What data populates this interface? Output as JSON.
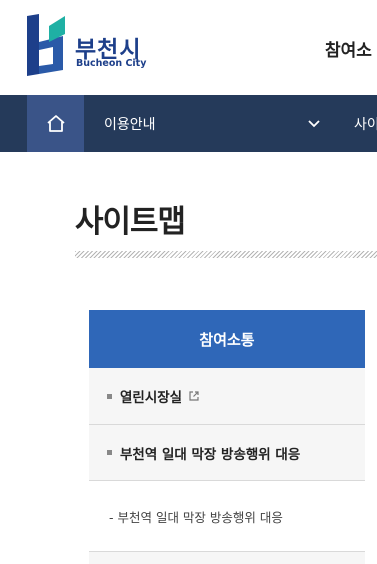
{
  "header": {
    "logo_ko": "부천시",
    "logo_en": "Bucheon City",
    "top_menu": "참여소"
  },
  "nav": {
    "home_icon": "home-icon",
    "item1": "이용안내",
    "item2": "사이"
  },
  "page": {
    "title": "사이트맵"
  },
  "sitemap": {
    "section_title": "참여소통",
    "items": [
      {
        "label": "열린시장실",
        "external": true
      },
      {
        "label": "부천역 일대 막장 방송행위 대응"
      }
    ],
    "sub_items": [
      {
        "label": "- 부천역 일대 막장 방송행위 대응"
      }
    ]
  },
  "colors": {
    "brand_blue": "#1d3f8a",
    "nav_bg": "#253a5a",
    "home_bg": "#3a5488",
    "section_head": "#2f67b8",
    "logo_teal": "#1fb0a4"
  }
}
